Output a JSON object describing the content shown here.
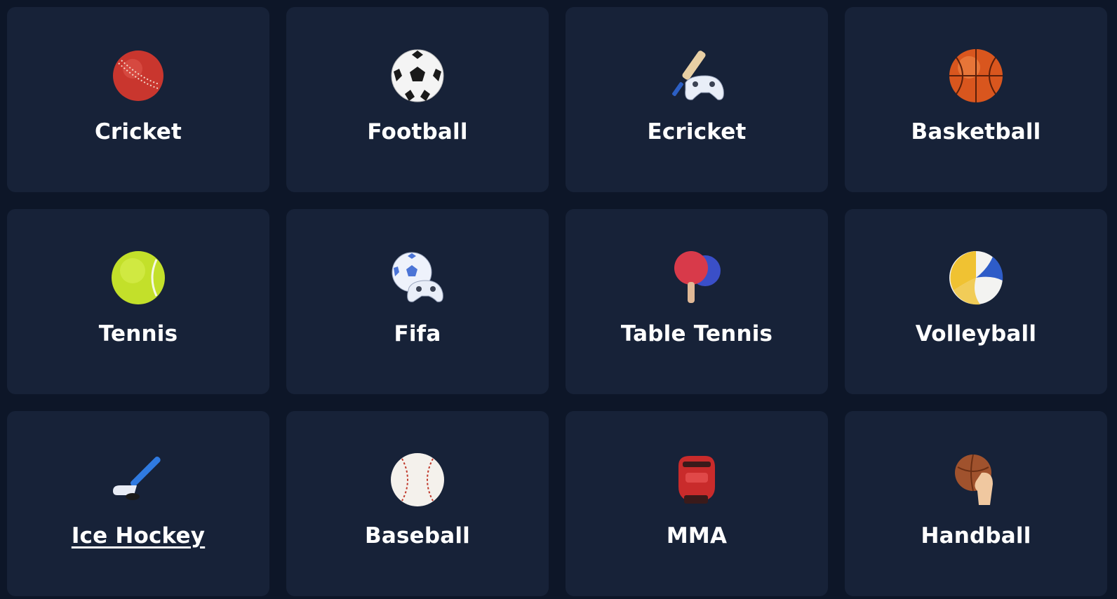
{
  "sports": [
    {
      "label": "Cricket",
      "icon": "cricket-ball-icon"
    },
    {
      "label": "Football",
      "icon": "soccer-ball-icon"
    },
    {
      "label": "Ecricket",
      "icon": "cricket-bat-gamepad-icon"
    },
    {
      "label": "Basketball",
      "icon": "basketball-icon"
    },
    {
      "label": "Tennis",
      "icon": "tennis-ball-icon"
    },
    {
      "label": "Fifa",
      "icon": "soccer-ball-gamepad-icon"
    },
    {
      "label": "Table Tennis",
      "icon": "table-tennis-paddle-icon"
    },
    {
      "label": "Volleyball",
      "icon": "volleyball-icon"
    },
    {
      "label": "Ice Hockey",
      "icon": "hockey-stick-icon"
    },
    {
      "label": "Baseball",
      "icon": "baseball-icon"
    },
    {
      "label": "MMA",
      "icon": "mma-glove-icon"
    },
    {
      "label": "Handball",
      "icon": "handball-icon"
    }
  ],
  "colors": {
    "background": "#0d1628",
    "card": "#172238",
    "text": "#ffffff"
  }
}
